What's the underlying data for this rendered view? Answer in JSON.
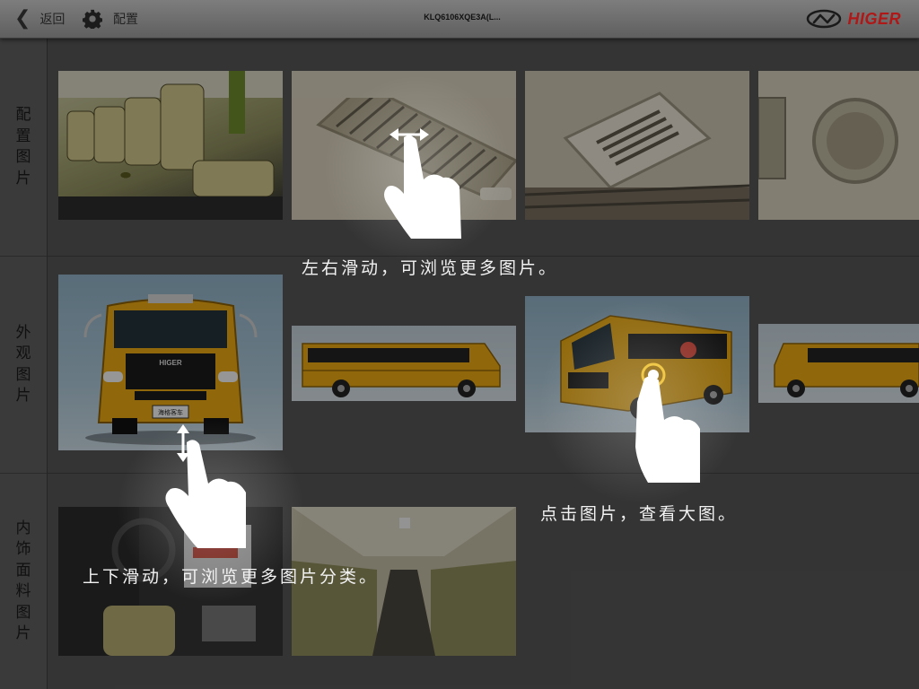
{
  "header": {
    "back_label": "返回",
    "config_label": "配置",
    "model_title": "KLQ6106XQE3A(L...",
    "brand_name": "HIGER"
  },
  "sidebar": {
    "categories": [
      {
        "label": "配置图片"
      },
      {
        "label": "外观图片"
      },
      {
        "label": "内饰面料图片"
      }
    ]
  },
  "gallery": {
    "rows": [
      {
        "name": "配置图片",
        "thumbs": [
          "seats",
          "ceiling-vent",
          "ceiling-vent-closeup",
          "speaker"
        ]
      },
      {
        "name": "外观图片",
        "thumbs": [
          "bus-front",
          "bus-side-left",
          "bus-front-three-quarter",
          "bus-side-right"
        ]
      },
      {
        "name": "内饰面料图片",
        "thumbs": [
          "dashboard",
          "interior-aisle"
        ]
      }
    ]
  },
  "bus_plate": "HIGER",
  "bus_sign": "海格客车",
  "hints": {
    "swipe_horizontal": "左右滑动，可浏览更多图片。",
    "tap_image": "点击图片，查看大图。",
    "swipe_vertical": "上下滑动，可浏览更多图片分类。"
  },
  "colors": {
    "brand_red": "#b01818",
    "bus_yellow": "#e8a812",
    "topbar": "#6e6e6e"
  }
}
